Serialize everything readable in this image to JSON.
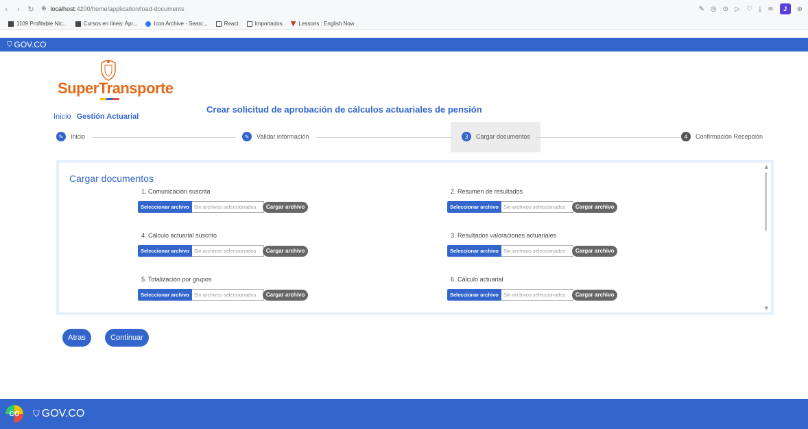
{
  "browser": {
    "url_host": "localhost",
    "url_path": ":4200/home/application/load-documents",
    "profile_initial": "J",
    "bookmarks": [
      {
        "label": "1109 Profitable Nic..."
      },
      {
        "label": "Cursos en línea: Apr..."
      },
      {
        "label": "Icon Archive - Searc..."
      },
      {
        "label": "React"
      },
      {
        "label": "Importados"
      },
      {
        "label": "Lessons : English Now"
      }
    ]
  },
  "gov": {
    "top_label": "GOV.CO",
    "bottom_label": "GOV.CO",
    "co_text": "CO"
  },
  "logo": {
    "text": "SuperTransporte"
  },
  "breadcrumb": {
    "home": "Inicio",
    "current": "Gestión Actuarial"
  },
  "page_title": "Crear solicitud de aprobación de cálculos actuariales de pensión",
  "stepper": {
    "steps": [
      {
        "label": "Inicio",
        "state": "done"
      },
      {
        "label": "Validar información",
        "state": "done"
      },
      {
        "label": "Cargar documentos",
        "number": "3",
        "state": "active"
      },
      {
        "label": "Confirmación Recepción",
        "number": "4",
        "state": "pending"
      }
    ]
  },
  "documents": {
    "title": "Cargar documentos",
    "select_label": "Seleccionar archivo",
    "no_file_label": "Sin archivos seleccionados",
    "upload_label": "Cargar archivo",
    "items": [
      {
        "label": "1. Comunicación suscrita"
      },
      {
        "label": "2. Resumen de resultados"
      },
      {
        "label": "4. Cálculo actuarial suscrito"
      },
      {
        "label": "3. Resultados valoraciones actuariales"
      },
      {
        "label": "5. Totalización por grupos"
      },
      {
        "label": "6. Cálculo actuarial"
      }
    ]
  },
  "actions": {
    "back": "Atras",
    "continue": "Continuar"
  },
  "colors": {
    "primary": "#3366cc",
    "brand_orange": "#e26b1b"
  }
}
